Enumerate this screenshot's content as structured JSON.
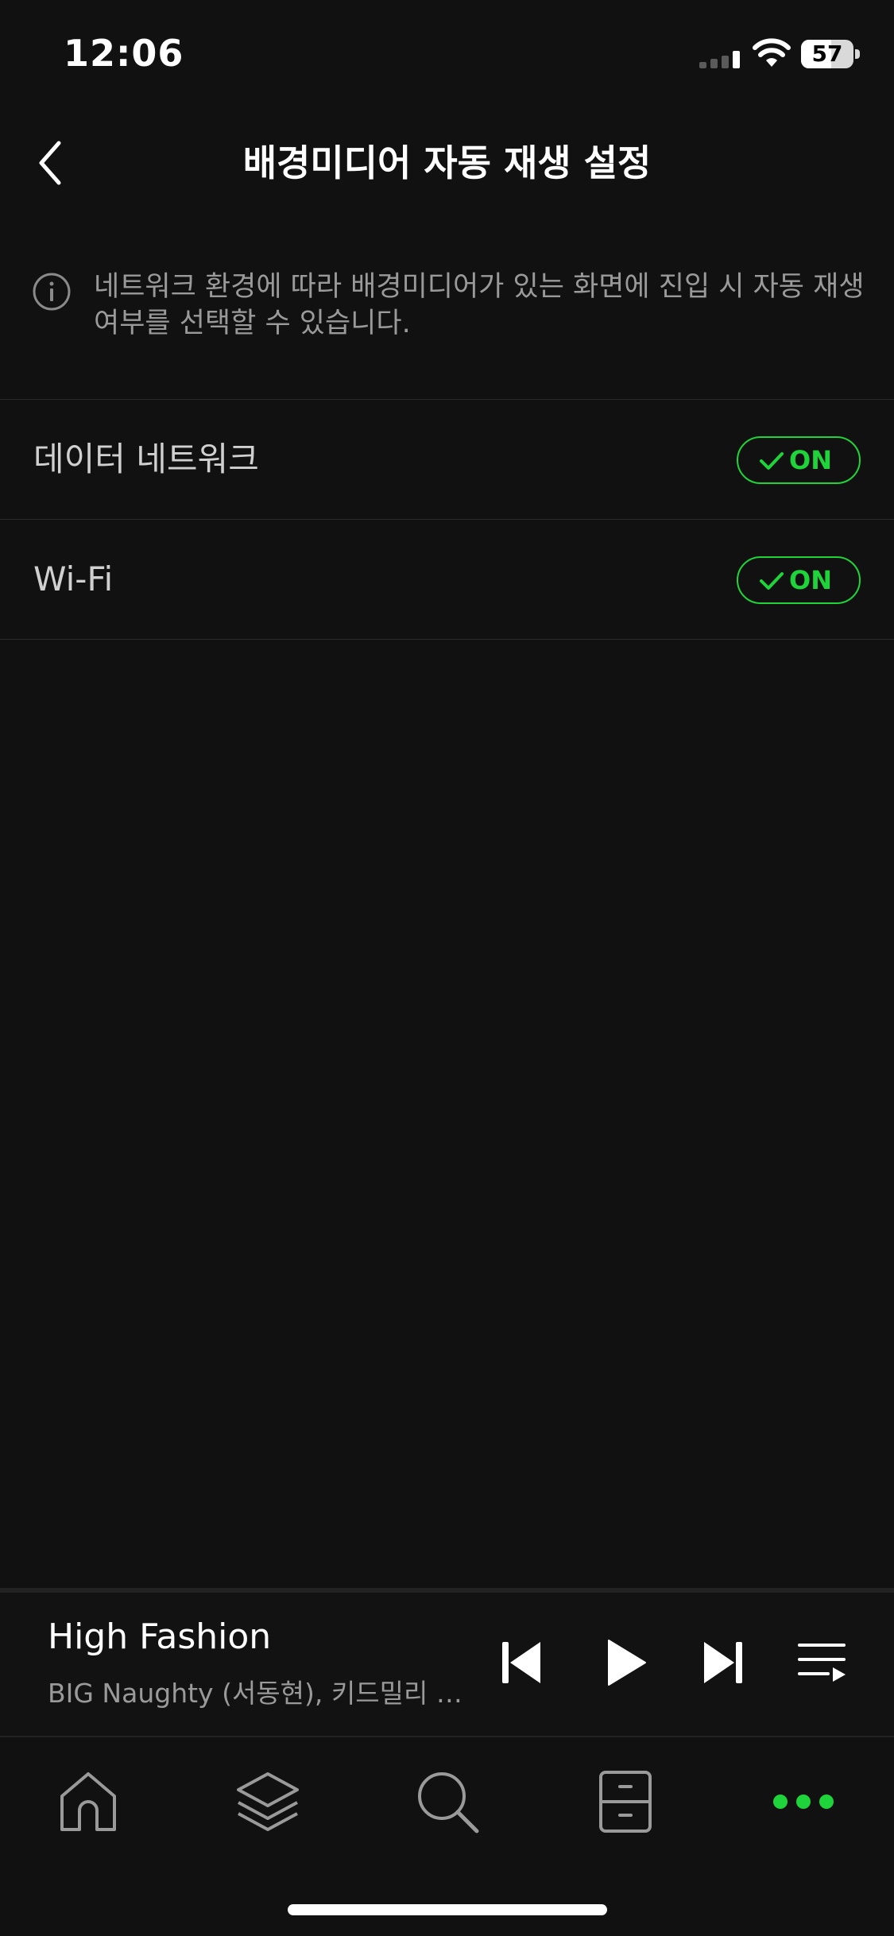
{
  "status_bar": {
    "time": "12:06",
    "battery_level": "57",
    "battery_fraction": 0.57
  },
  "header": {
    "title": "배경미디어 자동 재생 설정",
    "back_icon": "chevron-left-icon"
  },
  "info": {
    "icon": "info-circle-icon",
    "text": "네트워크 환경에 따라 배경미디어가 있는 화면에 진입 시 자동 재생 여부를 선택할 수 있습니다."
  },
  "settings": [
    {
      "label": "데이터 네트워크",
      "toggle_label": "ON",
      "enabled": true
    },
    {
      "label": "Wi-Fi",
      "toggle_label": "ON",
      "enabled": true
    }
  ],
  "player": {
    "title": "High Fashion",
    "artist": "BIG Naughty (서동현), 키드밀리 (Kid Milli)",
    "controls": [
      "skip-previous-icon",
      "play-icon",
      "skip-next-icon",
      "playlist-icon"
    ]
  },
  "tab_bar": {
    "tabs": [
      "home-icon",
      "layers-icon",
      "search-icon",
      "cabinet-icon",
      "more-dots-icon"
    ],
    "active_tab": "more-dots-icon"
  },
  "colors": {
    "background": "#111111",
    "accent": "#1ed43a",
    "text_primary": "#ffffff",
    "text_secondary": "#9a9a9a"
  }
}
